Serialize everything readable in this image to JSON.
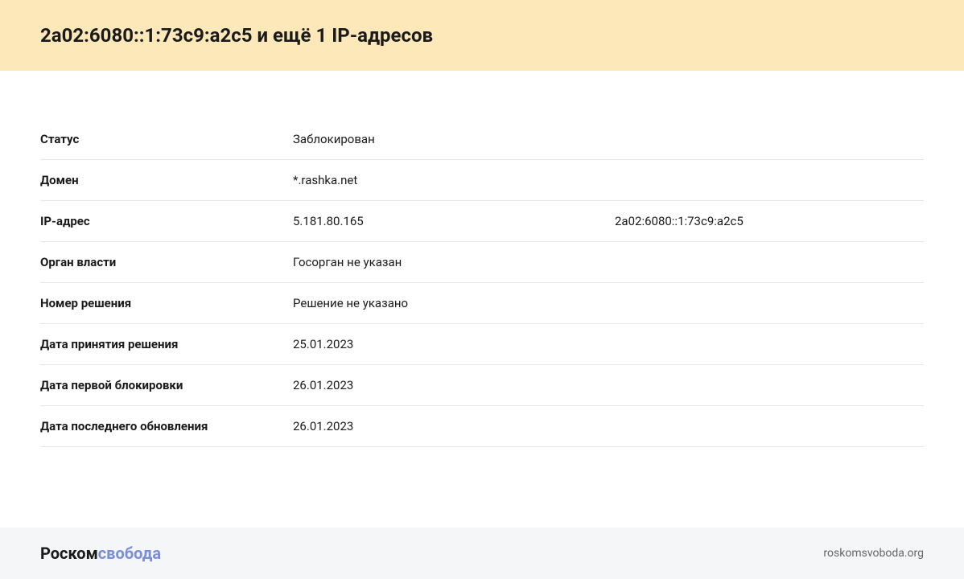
{
  "header": {
    "title": "2a02:6080::1:73c9:a2c5 и ещё 1 IP-адресов"
  },
  "rows": {
    "status": {
      "label": "Статус",
      "value": "Заблокирован"
    },
    "domain": {
      "label": "Домен",
      "value": "*.rashka.net"
    },
    "ip": {
      "label": "IP-адрес",
      "value1": "5.181.80.165",
      "value2": "2a02:6080::1:73c9:a2c5"
    },
    "authority": {
      "label": "Орган власти",
      "value": "Госорган не указан"
    },
    "decision_number": {
      "label": "Номер решения",
      "value": "Решение не указано"
    },
    "decision_date": {
      "label": "Дата принятия решения",
      "value": "25.01.2023"
    },
    "first_block_date": {
      "label": "Дата первой блокировки",
      "value": "26.01.2023"
    },
    "last_update_date": {
      "label": "Дата последнего обновления",
      "value": "26.01.2023"
    }
  },
  "footer": {
    "logo_part1": "Роском",
    "logo_part2": "свобода",
    "link": "roskomsvoboda.org"
  }
}
